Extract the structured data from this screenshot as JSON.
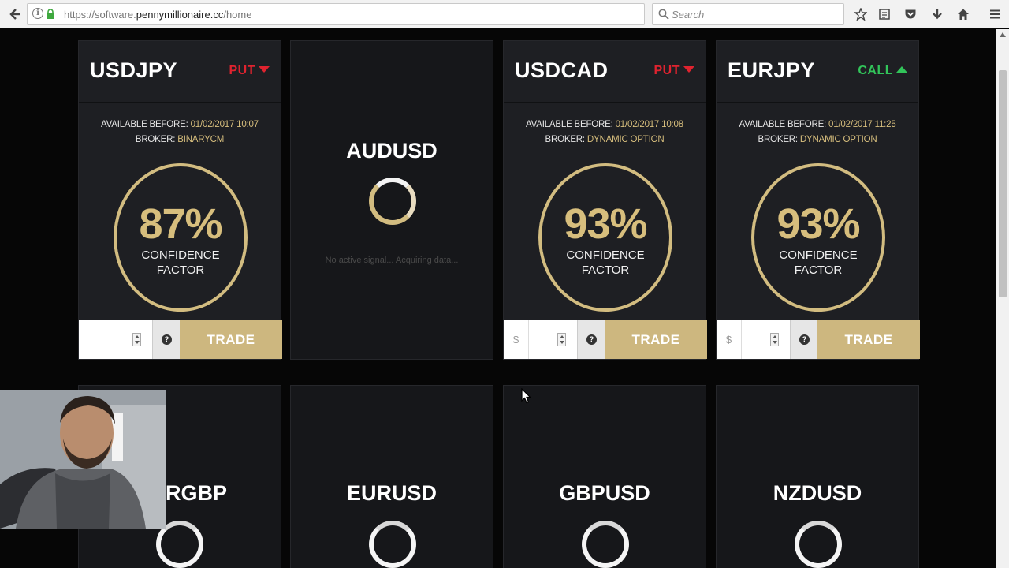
{
  "browser": {
    "url_prefix": "https://software.",
    "url_domain": "pennymillionaire.cc",
    "url_path": "/home",
    "search_placeholder": "Search"
  },
  "signals": [
    {
      "pair": "USDJPY",
      "direction": "PUT",
      "available_label": "AVAILABLE BEFORE:",
      "available": "01/02/2017 10:07",
      "broker_label": "BROKER:",
      "broker": "BINARYCM",
      "confidence": "87%",
      "confidence_line1": "CONFIDENCE",
      "confidence_line2": "FACTOR",
      "trade_label": "TRADE"
    },
    {
      "pair": "AUDUSD",
      "status": "No active signal... Acquiring data..."
    },
    {
      "pair": "USDCAD",
      "direction": "PUT",
      "available_label": "AVAILABLE BEFORE:",
      "available": "01/02/2017 10:08",
      "broker_label": "BROKER:",
      "broker": "DYNAMIC OPTION",
      "confidence": "93%",
      "confidence_line1": "CONFIDENCE",
      "confidence_line2": "FACTOR",
      "currency": "$",
      "trade_label": "TRADE"
    },
    {
      "pair": "EURJPY",
      "direction": "CALL",
      "available_label": "AVAILABLE BEFORE:",
      "available": "01/02/2017 11:25",
      "broker_label": "BROKER:",
      "broker": "DYNAMIC OPTION",
      "confidence": "93%",
      "confidence_line1": "CONFIDENCE",
      "confidence_line2": "FACTOR",
      "currency": "$",
      "trade_label": "TRADE"
    }
  ],
  "loading_pairs": [
    "RGBP",
    "EURUSD",
    "GBPUSD",
    "NZDUSD"
  ],
  "colors": {
    "gold": "#d2bc80",
    "put": "#e0232f",
    "call": "#32c45a",
    "card_bg": "#1e1f23",
    "page_bg": "#060606"
  }
}
